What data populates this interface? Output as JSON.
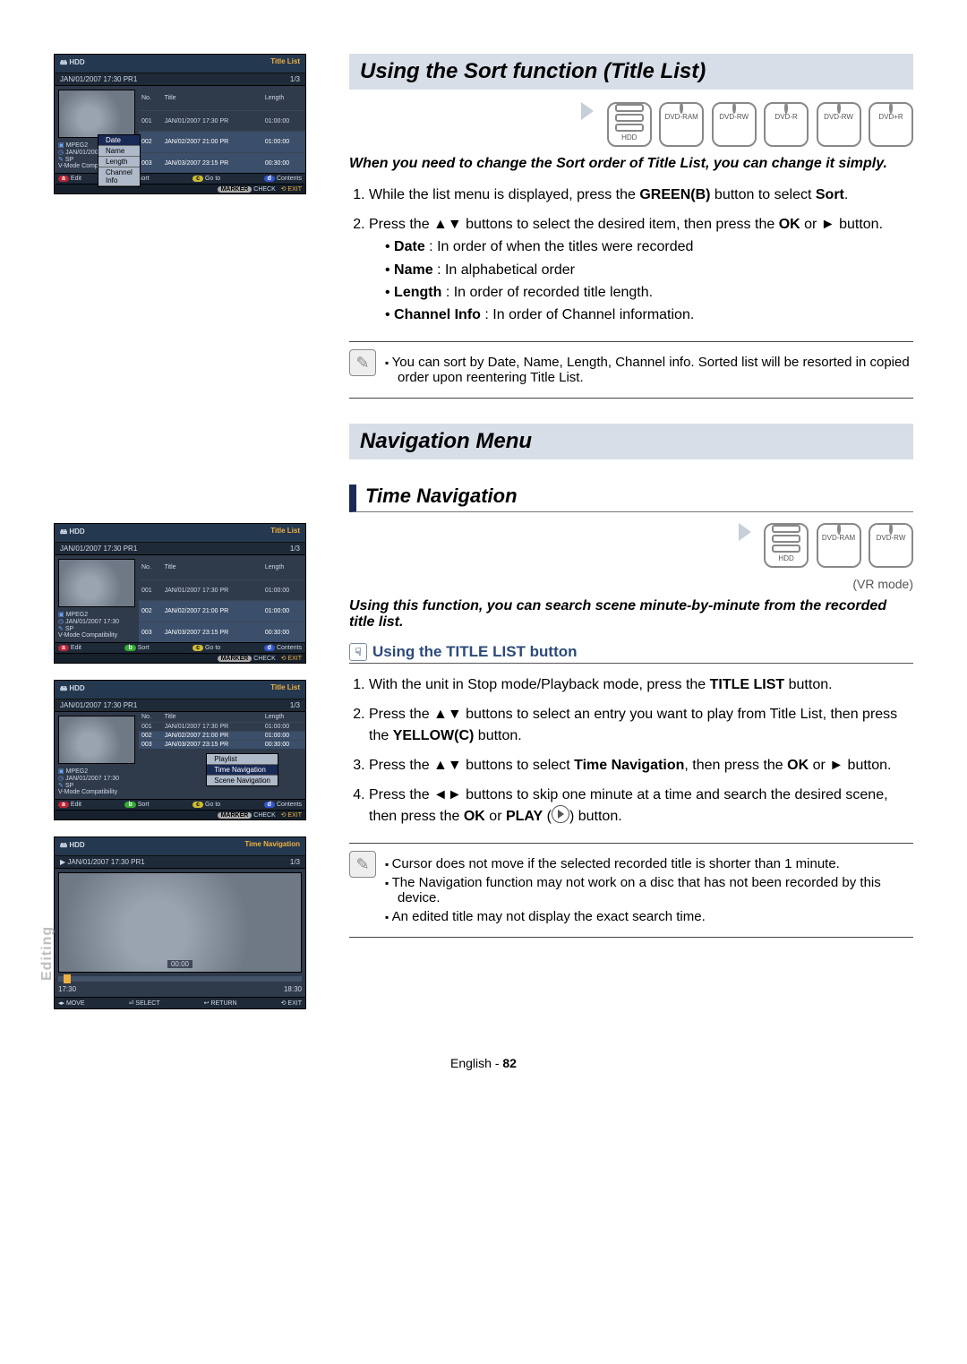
{
  "side_tab": "Editing",
  "page_footer_lang": "English",
  "page_footer_sep": " - ",
  "page_footer_num": "82",
  "section1": {
    "title": "Using the Sort function (Title List)",
    "discs": [
      "HDD",
      "DVD-RAM",
      "DVD-RW",
      "DVD-R",
      "DVD-RW",
      "DVD+R"
    ],
    "intro": "When you need to change the Sort order of Title List, you can change it simply.",
    "step1_a": "While the list menu is displayed, press the ",
    "step1_b": "GREEN(B)",
    "step1_c": " button to select ",
    "step1_d": "Sort",
    "step1_e": ".",
    "step2_a": "Press the ▲▼ buttons to select the desired item, then press the ",
    "step2_b": "OK",
    "step2_c": " or ► button.",
    "bullets": [
      {
        "k": "Date",
        "d": "In order of when the titles were recorded"
      },
      {
        "k": "Name",
        "d": "In alphabetical order"
      },
      {
        "k": "Length",
        "d": "In order of recorded title length."
      },
      {
        "k": "Channel Info",
        "d": "In order of Channel information."
      }
    ],
    "note": "You can sort by Date, Name, Length, Channel info. Sorted list will be resorted in copied order upon reentering Title List."
  },
  "nav_menu_title": "Navigation Menu",
  "section2": {
    "title": "Time Navigation",
    "discs": [
      "HDD",
      "DVD-RAM",
      "DVD-RW"
    ],
    "mode_note": "(VR mode)",
    "intro": "Using this function, you can search scene minute-by-minute from the recorded title list.",
    "using_title": "Using the TITLE LIST button",
    "step1_a": "With the unit in Stop mode/Playback mode, press the ",
    "step1_b": "TITLE LIST",
    "step1_c": " button.",
    "step2_a": "Press the ▲▼ buttons to select an entry you want to play from Title List, then press the ",
    "step2_b": "YELLOW(C)",
    "step2_c": " button.",
    "step3_a": "Press the ▲▼ buttons to select ",
    "step3_b": "Time Navigation",
    "step3_c": ", then press the ",
    "step3_d": "OK",
    "step3_e": " or ► button.",
    "step4_a": "Press the ◄► buttons to skip one minute at a time and search the desired scene, then press the ",
    "step4_b": "OK",
    "step4_c": " or ",
    "step4_d": "PLAY",
    "step4_e": " (",
    "step4_f": ") button.",
    "notes": [
      "Cursor does not move if the selected recorded title is shorter than 1 minute.",
      "The Navigation function may not work on a disc that has not been recorded by this device.",
      "An edited title may not display the exact search time."
    ]
  },
  "osd_common": {
    "hdd": "HDD",
    "title_list": "Title List",
    "page": "1/3",
    "current": "JAN/01/2007 17:30 PR1",
    "col_no": "No.",
    "col_title": "Title",
    "col_length": "Length",
    "rows": [
      {
        "no": "001",
        "title": "JAN/01/2007 17:30 PR",
        "len": "01:00:00"
      },
      {
        "no": "002",
        "title": "JAN/02/2007 21:00 PR",
        "len": "01:00:00"
      },
      {
        "no": "003",
        "title": "JAN/03/2007 23:15 PR",
        "len": "00:30:00"
      }
    ],
    "side": [
      {
        "ico": "▣",
        "txt": "MPEG2"
      },
      {
        "ico": "◷",
        "txt": "JAN/01/2007 17:30"
      },
      {
        "ico": "✎",
        "txt": "SP"
      },
      {
        "ico": "",
        "txt": "V-Mode Compatibility"
      }
    ],
    "foot": {
      "a": "Edit",
      "b": "Sort",
      "c": "Go to",
      "d": "Contents",
      "marker": "MARKER",
      "check": "CHECK",
      "return": "↩ RETURN",
      "exit": "⟲ EXIT",
      "move": "◂▸ MOVE",
      "select": "⏎ SELECT"
    }
  },
  "osd1_menu": [
    "Date",
    "Name",
    "Length",
    "Channel Info"
  ],
  "osd3_menu": [
    "Playlist",
    "Time Navigation",
    "Scene Navigation"
  ],
  "osd4": {
    "header": "Time Navigation",
    "play_icon": "▶",
    "center_time": "00:00",
    "t_start": "17:30",
    "t_end": "18:30"
  }
}
